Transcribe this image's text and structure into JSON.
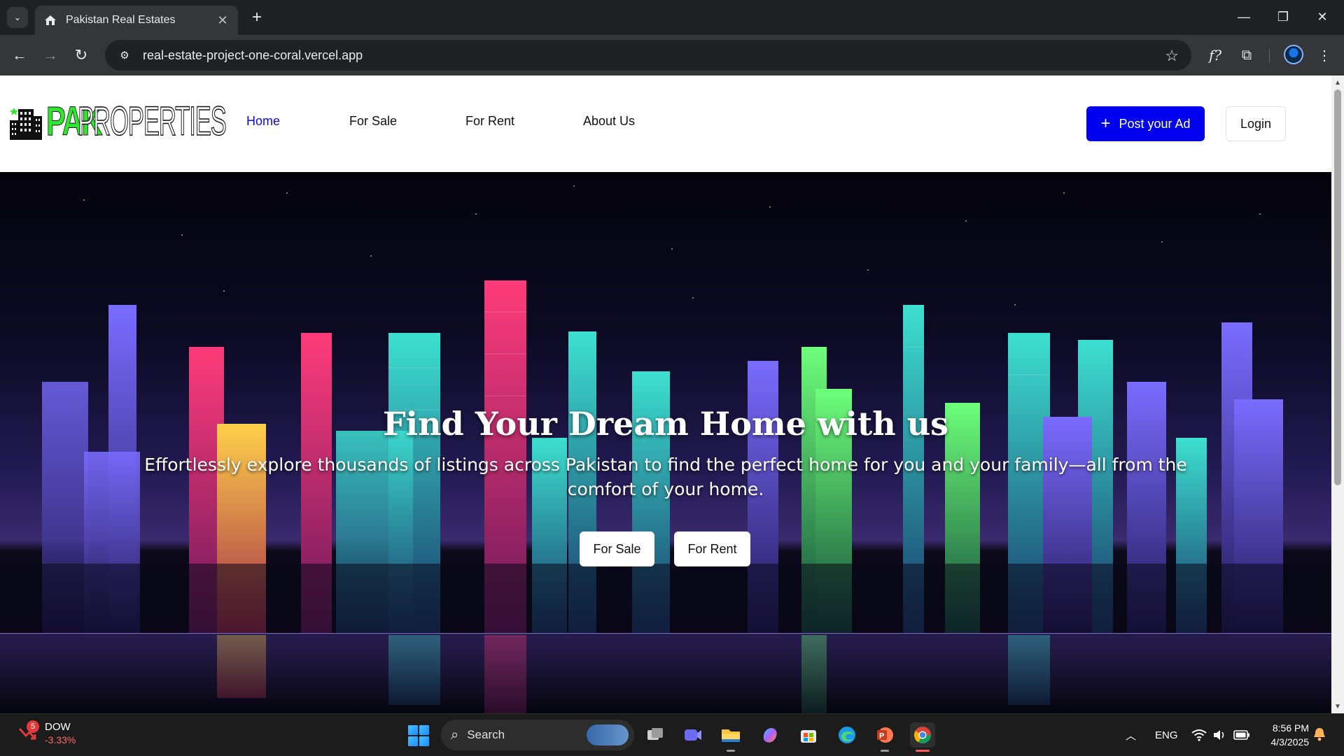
{
  "browser": {
    "tab_title": "Pakistan Real Estates",
    "url": "real-estate-project-one-coral.vercel.app",
    "icons": {
      "tab_list": "chevron-down-icon",
      "close_tab": "close-icon",
      "new_tab": "plus-icon",
      "back": "arrow-left-icon",
      "forward": "arrow-right-icon",
      "reload": "reload-icon",
      "site_info": "tune-icon",
      "bookmark": "star-icon",
      "extension_fx": "function-icon",
      "extensions": "puzzle-icon",
      "menu": "kebab-menu-icon"
    }
  },
  "site": {
    "logo": {
      "part1": "PAK",
      "part2": "PROPERTIES"
    },
    "nav": [
      {
        "label": "Home",
        "active": true
      },
      {
        "label": "For Sale",
        "active": false
      },
      {
        "label": "For Rent",
        "active": false
      },
      {
        "label": "About Us",
        "active": false
      }
    ],
    "post_ad_label": "Post your Ad",
    "login_label": "Login",
    "colors": {
      "accent_blue": "#0000ee",
      "logo_green": "#2ee62e"
    }
  },
  "hero": {
    "title": "Find Your Dream Home with us",
    "subtitle": "Effortlessly explore thousands of listings across Pakistan to find the perfect home for you and your family—all from the comfort of your home.",
    "buttons": [
      "For Sale",
      "For Rent"
    ]
  },
  "taskbar": {
    "stock": {
      "name": "DOW",
      "change": "-3.33%",
      "badge": "5"
    },
    "search_placeholder": "Search",
    "apps": [
      "start-icon",
      "task-view-icon",
      "teams-meet-icon",
      "file-explorer-icon",
      "copilot-icon",
      "microsoft-store-icon",
      "edge-icon",
      "powerpoint-icon",
      "chrome-icon"
    ],
    "tray": {
      "language": "ENG"
    },
    "clock": {
      "time": "8:56 PM",
      "date": "4/3/2025"
    }
  }
}
